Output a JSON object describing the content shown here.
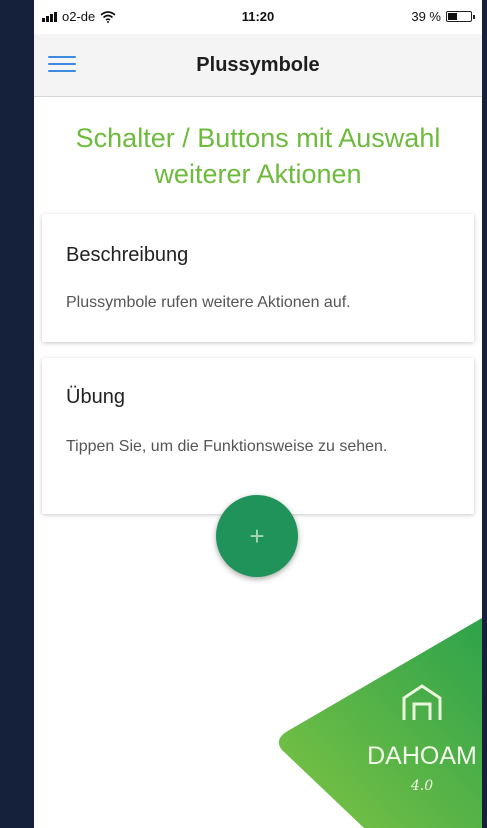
{
  "status_bar": {
    "carrier": "o2-de",
    "time": "11:20",
    "battery": "39 %",
    "battery_level": 0.39
  },
  "nav": {
    "title": "Plussymbole",
    "menu_icon": "hamburger-menu-icon"
  },
  "heading": {
    "line1": "Schalter / Buttons mit Auswahl",
    "line2": "weiterer Aktionen"
  },
  "cards": [
    {
      "title": "Beschreibung",
      "text": "Plussymbole rufen weitere Aktionen auf."
    },
    {
      "title": "Übung",
      "text": "Tippen Sie, um die Funktionsweise zu sehen."
    }
  ],
  "fab": {
    "label": "+",
    "icon": "plus-icon"
  },
  "logo": {
    "text": "DAHOAM",
    "version": "4.0"
  },
  "colors": {
    "accent_green": "#6dbb3c",
    "fab_green": "#20935a",
    "menu_blue": "#3b8be0",
    "frame": "#15213a"
  }
}
